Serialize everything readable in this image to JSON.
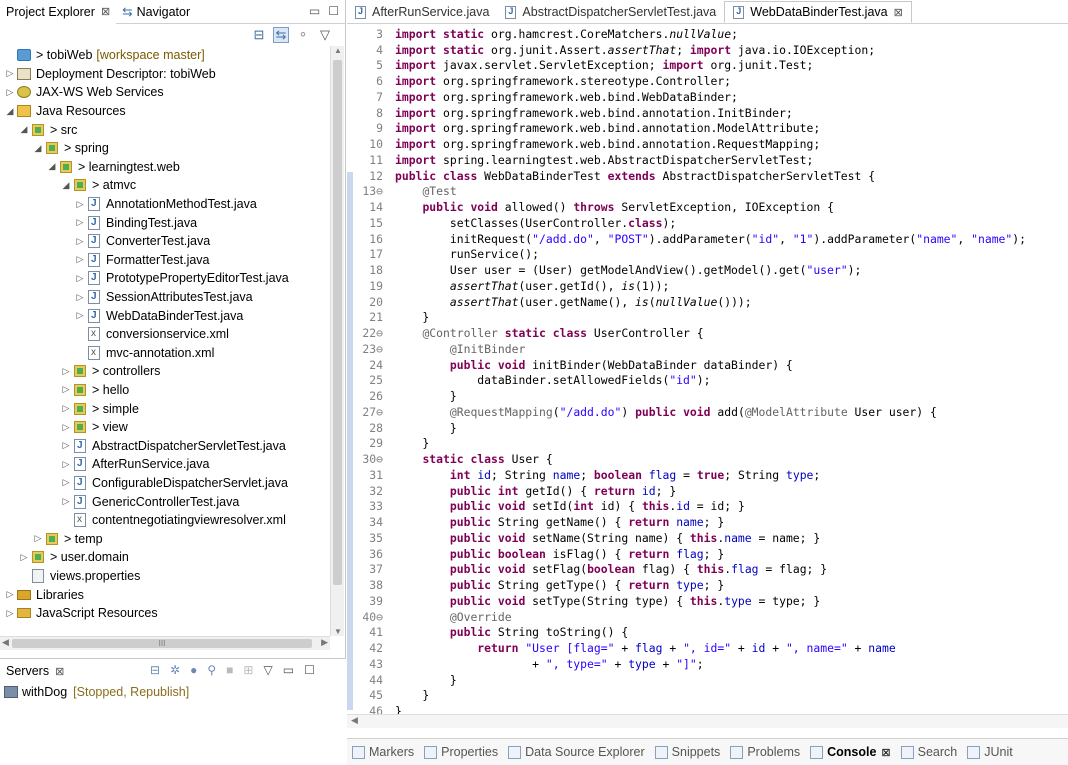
{
  "left_pane": {
    "tabs": [
      {
        "label": "Project Explorer",
        "close": "⊠"
      },
      {
        "label": "Navigator"
      }
    ],
    "tree": [
      {
        "depth": 0,
        "twisty": "",
        "icon": "proj",
        "label": "> tobiWeb",
        "deco": "[workspace master]"
      },
      {
        "depth": 0,
        "twisty": "▷",
        "icon": "dd",
        "label": "Deployment Descriptor: tobiWeb",
        "deco": ""
      },
      {
        "depth": 0,
        "twisty": "▷",
        "icon": "ws",
        "label": "JAX-WS Web Services",
        "deco": ""
      },
      {
        "depth": 0,
        "twisty": "◢",
        "icon": "jr",
        "label": "Java Resources",
        "deco": ""
      },
      {
        "depth": 1,
        "twisty": "◢",
        "icon": "pkg",
        "label": "> src",
        "deco": ""
      },
      {
        "depth": 2,
        "twisty": "◢",
        "icon": "pkg",
        "label": "> spring",
        "deco": ""
      },
      {
        "depth": 3,
        "twisty": "◢",
        "icon": "pkg",
        "label": "> learningtest.web",
        "deco": ""
      },
      {
        "depth": 4,
        "twisty": "◢",
        "icon": "pkg",
        "label": "> atmvc",
        "deco": ""
      },
      {
        "depth": 5,
        "twisty": "▷",
        "icon": "java",
        "label": "AnnotationMethodTest.java",
        "deco": ""
      },
      {
        "depth": 5,
        "twisty": "▷",
        "icon": "java",
        "label": "BindingTest.java",
        "deco": ""
      },
      {
        "depth": 5,
        "twisty": "▷",
        "icon": "java",
        "label": "ConverterTest.java",
        "deco": ""
      },
      {
        "depth": 5,
        "twisty": "▷",
        "icon": "java",
        "label": "FormatterTest.java",
        "deco": ""
      },
      {
        "depth": 5,
        "twisty": "▷",
        "icon": "java",
        "label": "PrototypePropertyEditorTest.java",
        "deco": ""
      },
      {
        "depth": 5,
        "twisty": "▷",
        "icon": "java",
        "label": "SessionAttributesTest.java",
        "deco": ""
      },
      {
        "depth": 5,
        "twisty": "▷",
        "icon": "java",
        "label": "WebDataBinderTest.java",
        "deco": ""
      },
      {
        "depth": 5,
        "twisty": "",
        "icon": "xml",
        "label": "conversionservice.xml",
        "deco": ""
      },
      {
        "depth": 5,
        "twisty": "",
        "icon": "xml",
        "label": "mvc-annotation.xml",
        "deco": ""
      },
      {
        "depth": 4,
        "twisty": "▷",
        "icon": "pkg",
        "label": "> controllers",
        "deco": ""
      },
      {
        "depth": 4,
        "twisty": "▷",
        "icon": "pkg",
        "label": "> hello",
        "deco": ""
      },
      {
        "depth": 4,
        "twisty": "▷",
        "icon": "pkg",
        "label": "> simple",
        "deco": ""
      },
      {
        "depth": 4,
        "twisty": "▷",
        "icon": "pkg",
        "label": "> view",
        "deco": ""
      },
      {
        "depth": 4,
        "twisty": "▷",
        "icon": "java",
        "label": "AbstractDispatcherServletTest.java",
        "deco": ""
      },
      {
        "depth": 4,
        "twisty": "▷",
        "icon": "java",
        "label": "AfterRunService.java",
        "deco": ""
      },
      {
        "depth": 4,
        "twisty": "▷",
        "icon": "java",
        "label": "ConfigurableDispatcherServlet.java",
        "deco": ""
      },
      {
        "depth": 4,
        "twisty": "▷",
        "icon": "java",
        "label": "GenericControllerTest.java",
        "deco": ""
      },
      {
        "depth": 4,
        "twisty": "",
        "icon": "xml",
        "label": "contentnegotiatingviewresolver.xml",
        "deco": ""
      },
      {
        "depth": 2,
        "twisty": "▷",
        "icon": "pkg",
        "label": "> temp",
        "deco": ""
      },
      {
        "depth": 1,
        "twisty": "▷",
        "icon": "pkg",
        "label": "> user.domain",
        "deco": ""
      },
      {
        "depth": 1,
        "twisty": "",
        "icon": "prop",
        "label": "views.properties",
        "deco": ""
      },
      {
        "depth": 0,
        "twisty": "▷",
        "icon": "lib",
        "label": "Libraries",
        "deco": ""
      },
      {
        "depth": 0,
        "twisty": "▷",
        "icon": "jsres",
        "label": "JavaScript Resources",
        "deco": ""
      }
    ],
    "scroll_grip": "III"
  },
  "servers": {
    "tab_label": "Servers",
    "close": "⊠",
    "items": [
      {
        "name": "withDog",
        "status": "[Stopped, Republish]"
      }
    ]
  },
  "editor": {
    "tabs": [
      {
        "label": "AfterRunService.java",
        "active": false
      },
      {
        "label": "AbstractDispatcherServletTest.java",
        "active": false
      },
      {
        "label": "WebDataBinderTest.java",
        "active": true
      }
    ],
    "close": "⊠",
    "lines": [
      {
        "n": "3",
        "html": "<span class='kw'>import</span> <span class='kw'>static</span> org.hamcrest.CoreMatchers.<span class='it'>nullValue</span>;"
      },
      {
        "n": "4",
        "html": "<span class='kw'>import</span> <span class='kw'>static</span> org.junit.Assert.<span class='it'>assertThat</span>; <span class='kw'>import</span> java.io.IOException;"
      },
      {
        "n": "5",
        "html": "<span class='kw'>import</span> javax.servlet.ServletException; <span class='kw'>import</span> org.junit.Test;"
      },
      {
        "n": "6",
        "html": "<span class='kw'>import</span> org.springframework.stereotype.Controller;"
      },
      {
        "n": "7",
        "html": "<span class='kw'>import</span> org.springframework.web.bind.WebDataBinder;"
      },
      {
        "n": "8",
        "html": "<span class='kw'>import</span> org.springframework.web.bind.annotation.InitBinder;"
      },
      {
        "n": "9",
        "html": "<span class='kw'>import</span> org.springframework.web.bind.annotation.ModelAttribute;"
      },
      {
        "n": "10",
        "html": "<span class='kw'>import</span> org.springframework.web.bind.annotation.RequestMapping;"
      },
      {
        "n": "11",
        "html": "<span class='kw'>import</span> spring.learningtest.web.AbstractDispatcherServletTest;"
      },
      {
        "n": "12",
        "html": "<span class='kw'>public</span> <span class='kw'>class</span> WebDataBinderTest <span class='kw'>extends</span> AbstractDispatcherServletTest {"
      },
      {
        "n": "13⊖",
        "html": "    <span class='ann'>@Test</span>"
      },
      {
        "n": "14",
        "html": "    <span class='kw'>public</span> <span class='kw'>void</span> allowed() <span class='kw'>throws</span> ServletException, IOException {"
      },
      {
        "n": "15",
        "html": "        setClasses(UserController.<span class='kw'>class</span>);"
      },
      {
        "n": "16",
        "html": "        initRequest(<span class='str'>\"/add.do\"</span>, <span class='str'>\"POST\"</span>).addParameter(<span class='str'>\"id\"</span>, <span class='str'>\"1\"</span>).addParameter(<span class='str'>\"name\"</span>, <span class='str'>\"name\"</span>);"
      },
      {
        "n": "17",
        "html": "        runService();"
      },
      {
        "n": "18",
        "html": "        User user = (User) getModelAndView().getModel().get(<span class='str'>\"user\"</span>);"
      },
      {
        "n": "19",
        "html": "        <span class='it'>assertThat</span>(user.getId(), <span class='it'>is</span>(1));"
      },
      {
        "n": "20",
        "html": "        <span class='it'>assertThat</span>(user.getName(), <span class='it'>is</span>(<span class='it'>nullValue</span>()));"
      },
      {
        "n": "21",
        "html": "    }"
      },
      {
        "n": "22⊖",
        "html": "    <span class='ann'>@Controller</span> <span class='kw'>static</span> <span class='kw'>class</span> UserController {"
      },
      {
        "n": "23⊖",
        "html": "        <span class='ann'>@InitBinder</span>"
      },
      {
        "n": "24",
        "html": "        <span class='kw'>public</span> <span class='kw'>void</span> initBinder(WebDataBinder dataBinder) {"
      },
      {
        "n": "25",
        "html": "            dataBinder.setAllowedFields(<span class='str'>\"id\"</span>);"
      },
      {
        "n": "26",
        "html": "        }"
      },
      {
        "n": "27⊖",
        "html": "        <span class='ann'>@RequestMapping</span>(<span class='str'>\"/add.do\"</span>) <span class='kw'>public</span> <span class='kw'>void</span> add(<span class='ann'>@ModelAttribute</span> User user) {"
      },
      {
        "n": "28",
        "html": "        }"
      },
      {
        "n": "29",
        "html": "    }"
      },
      {
        "n": "30⊖",
        "html": "    <span class='kw'>static</span> <span class='kw'>class</span> User {"
      },
      {
        "n": "31",
        "html": "        <span class='kw'>int</span> <span class='fld'>id</span>; String <span class='fld'>name</span>; <span class='kw'>boolean</span> <span class='fld'>flag</span> = <span class='kw'>true</span>; String <span class='fld'>type</span>;"
      },
      {
        "n": "32",
        "html": "        <span class='kw'>public</span> <span class='kw'>int</span> getId() { <span class='kw'>return</span> <span class='fld'>id</span>; }"
      },
      {
        "n": "33",
        "html": "        <span class='kw'>public</span> <span class='kw'>void</span> setId(<span class='kw'>int</span> id) { <span class='kw'>this</span>.<span class='fld'>id</span> = id; }"
      },
      {
        "n": "34",
        "html": "        <span class='kw'>public</span> String getName() { <span class='kw'>return</span> <span class='fld'>name</span>; }"
      },
      {
        "n": "35",
        "html": "        <span class='kw'>public</span> <span class='kw'>void</span> setName(String name) { <span class='kw'>this</span>.<span class='fld'>name</span> = name; }"
      },
      {
        "n": "36",
        "html": "        <span class='kw'>public</span> <span class='kw'>boolean</span> isFlag() { <span class='kw'>return</span> <span class='fld'>flag</span>; }"
      },
      {
        "n": "37",
        "html": "        <span class='kw'>public</span> <span class='kw'>void</span> setFlag(<span class='kw'>boolean</span> flag) { <span class='kw'>this</span>.<span class='fld'>flag</span> = flag; }"
      },
      {
        "n": "38",
        "html": "        <span class='kw'>public</span> String getType() { <span class='kw'>return</span> <span class='fld'>type</span>; }"
      },
      {
        "n": "39",
        "html": "        <span class='kw'>public</span> <span class='kw'>void</span> setType(String type) { <span class='kw'>this</span>.<span class='fld'>type</span> = type; }"
      },
      {
        "n": "40⊖",
        "html": "        <span class='ann'>@Override</span>"
      },
      {
        "n": "41",
        "html": "        <span class='kw'>public</span> String toString() {"
      },
      {
        "n": "42",
        "html": "            <span class='kw'>return</span> <span class='str'>\"User [flag=\"</span> + <span class='fld'>flag</span> + <span class='str'>\", id=\"</span> + <span class='fld'>id</span> + <span class='str'>\", name=\"</span> + <span class='fld'>name</span>"
      },
      {
        "n": "43",
        "html": "                    + <span class='str'>\", type=\"</span> + <span class='fld'>type</span> + <span class='str'>\"]\"</span>;"
      },
      {
        "n": "44",
        "html": "        }"
      },
      {
        "n": "45",
        "html": "    }"
      },
      {
        "n": "46",
        "html": "}"
      }
    ]
  },
  "bottom_tabs": [
    {
      "label": "Markers",
      "active": false
    },
    {
      "label": "Properties",
      "active": false
    },
    {
      "label": "Data Source Explorer",
      "active": false
    },
    {
      "label": "Snippets",
      "active": false
    },
    {
      "label": "Problems",
      "active": false
    },
    {
      "label": "Console",
      "active": true
    },
    {
      "label": "Search",
      "active": false
    },
    {
      "label": "JUnit",
      "active": false
    }
  ]
}
